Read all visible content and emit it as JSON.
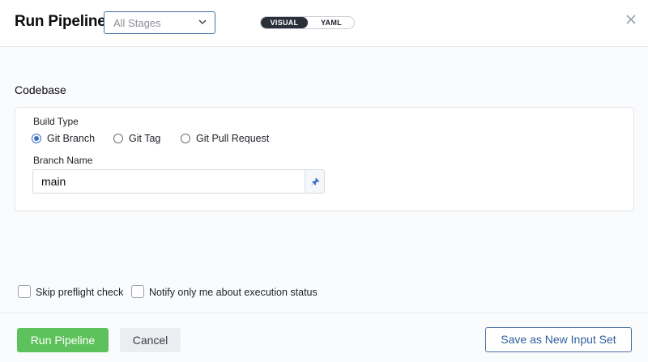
{
  "header": {
    "title": "Run Pipeline",
    "stage_select": "All Stages",
    "view_toggle": {
      "visual": "VISUAL",
      "yaml": "YAML",
      "selected": "VISUAL"
    }
  },
  "codebase": {
    "section_title": "Codebase",
    "build_type_label": "Build Type",
    "build_types": [
      {
        "label": "Git Branch",
        "selected": true
      },
      {
        "label": "Git Tag",
        "selected": false
      },
      {
        "label": "Git Pull Request",
        "selected": false
      }
    ],
    "branch_name_label": "Branch Name",
    "branch_name_value": "main"
  },
  "options": {
    "skip_preflight": {
      "label": "Skip preflight check",
      "checked": false
    },
    "notify_only_me": {
      "label": "Notify only me about execution status",
      "checked": false
    }
  },
  "footer": {
    "run_label": "Run Pipeline",
    "cancel_label": "Cancel",
    "save_input_set_label": "Save as New Input Set"
  },
  "colors": {
    "primary_green": "#5ec25c",
    "accent_blue": "#3b6fc6",
    "toggle_dark": "#2b2f3a"
  }
}
